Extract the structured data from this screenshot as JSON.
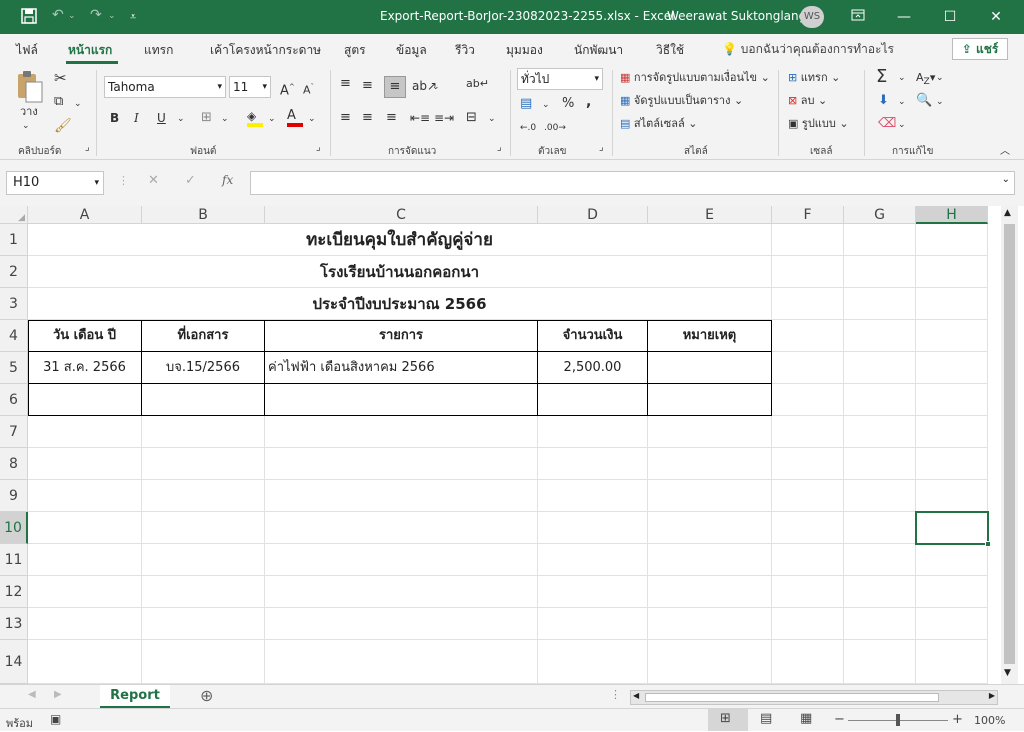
{
  "title_bar": {
    "title": "Export-Report-BorJor-23082023-2255.xlsx  -  Excel",
    "user_name": "Weerawat Suktonglang",
    "user_initials": "WS"
  },
  "ribbon_tabs": [
    "ไฟล์",
    "หน้าแรก",
    "แทรก",
    "เค้าโครงหน้ากระดาษ",
    "สูตร",
    "ข้อมูล",
    "รีวิว",
    "มุมมอง",
    "นักพัฒนา",
    "วิธีใช้"
  ],
  "active_tab": "หน้าแรก",
  "tell_me": "บอกฉันว่าคุณต้องการทำอะไร",
  "share_label": "แชร์",
  "ribbon": {
    "paste_label": "วาง",
    "font_name": "Tahoma",
    "font_size": "11",
    "number_format": "ทั่วไป",
    "conditional_formatting": "การจัดรูปแบบตามเงื่อนไข",
    "format_as_table": "จัดรูปแบบเป็นตาราง",
    "cell_styles": "สไตล์เซลล์",
    "insert": "แทรก",
    "delete": "ลบ",
    "format": "รูปแบบ",
    "groups": {
      "clipboard": "คลิปบอร์ด",
      "font": "ฟอนต์",
      "alignment": "การจัดแนว",
      "number": "ตัวเลข",
      "styles": "สไตล์",
      "cells": "เซลล์",
      "editing": "การแก้ไข"
    }
  },
  "formula_bar": {
    "name_box": "H10",
    "fx": "fx",
    "value": ""
  },
  "columns": [
    "A",
    "B",
    "C",
    "D",
    "E",
    "F",
    "G",
    "H"
  ],
  "rows": [
    "1",
    "2",
    "3",
    "4",
    "5",
    "6",
    "7",
    "8",
    "9",
    "10",
    "11",
    "12",
    "13",
    "14"
  ],
  "selected_cell": "H10",
  "sheet": {
    "title1": "ทะเบียนคุมใบสำคัญคู่จ่าย",
    "title2": "โรงเรียนบ้านนอกคอกนา",
    "title3": "ประจำปีงบประมาณ 2566",
    "headers": [
      "วัน เดือน ปี",
      "ที่เอกสาร",
      "รายการ",
      "จำนวนเงิน",
      "หมายเหตุ"
    ],
    "rows": [
      [
        "31 ส.ค. 2566",
        "บจ.15/2566",
        "ค่าไฟฟ้า เดือนสิงหาคม 2566",
        "2,500.00",
        ""
      ],
      [
        "",
        "",
        "",
        "",
        ""
      ]
    ]
  },
  "sheet_tabs": [
    "Report"
  ],
  "status": {
    "ready": "พร้อม",
    "zoom": "100%"
  },
  "colors": {
    "accent": "#217346"
  }
}
